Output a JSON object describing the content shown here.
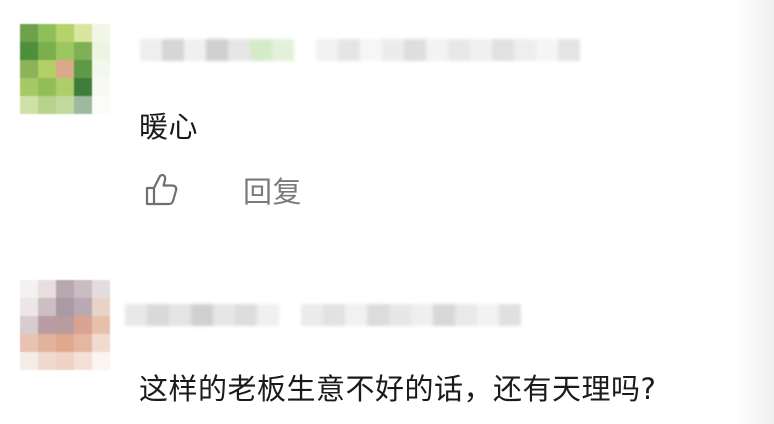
{
  "comments": [
    {
      "text": "暖心",
      "actions": {
        "like_icon": "thumbs-up-icon",
        "reply_label": "回复"
      },
      "avatar_colors": [
        "#6fa04a",
        "#8fbf5a",
        "#b5d36a",
        "#d8e6a0",
        "#f2f6e6",
        "#4e8f3c",
        "#79b04c",
        "#9cc65f",
        "#7fb055",
        "#eef4e2",
        "#8ab35a",
        "#b4cf66",
        "#d9a98a",
        "#5e9a45",
        "#f4f8ec",
        "#a7c965",
        "#92bd58",
        "#b0cd6c",
        "#3f7d3a",
        "#f7faf2",
        "#cfe1a7",
        "#b7d28a",
        "#c2d9a0",
        "#9db9a0",
        "#fbfcf8"
      ],
      "name_blur_colors": [
        "#eeeeee",
        "#d6d6d6",
        "#f0f0f0",
        "#cfcfcf",
        "#e6e6e6",
        "#d5ebc8",
        "#e3f0da",
        "#ffffff",
        "#f2f2f2",
        "#e5e5e5",
        "#f6f6f6",
        "#ececec",
        "#dedede",
        "#f3f3f3",
        "#e8e8e8",
        "#f0f0f0",
        "#e1e1e1",
        "#eeeeee",
        "#f5f5f5",
        "#e4e4e4"
      ]
    },
    {
      "text": "这样的老板生意不好的话，还有天理吗?",
      "avatar_colors": [
        "#f4f1f1",
        "#e7dedd",
        "#b7a8ad",
        "#c9bcc2",
        "#e4dcdf",
        "#ece6e7",
        "#cbbfc3",
        "#a99aa4",
        "#b9a9b2",
        "#e9d3c8",
        "#d8ccd0",
        "#b89ea4",
        "#b99c9e",
        "#d8a391",
        "#e7c0ac",
        "#e8c3b2",
        "#e2b29c",
        "#e1a88f",
        "#e5b6a0",
        "#f1dbcf",
        "#f6ece6",
        "#f0dad0",
        "#eed3c6",
        "#f3e1d8",
        "#fbf4f0"
      ],
      "name_blur_colors": [
        "#e8e8e8",
        "#d9d9d9",
        "#e4e4e4",
        "#d0d0d0",
        "#e6e6e6",
        "#dddddd",
        "#f0f0f0",
        "#ffffff",
        "#ebebeb",
        "#e2e2e2",
        "#f1f1f1",
        "#dcdcdc",
        "#e7e7e7",
        "#efefef",
        "#d8d8d8",
        "#e9e9e9",
        "#f2f2f2",
        "#e0e0e0"
      ]
    }
  ]
}
